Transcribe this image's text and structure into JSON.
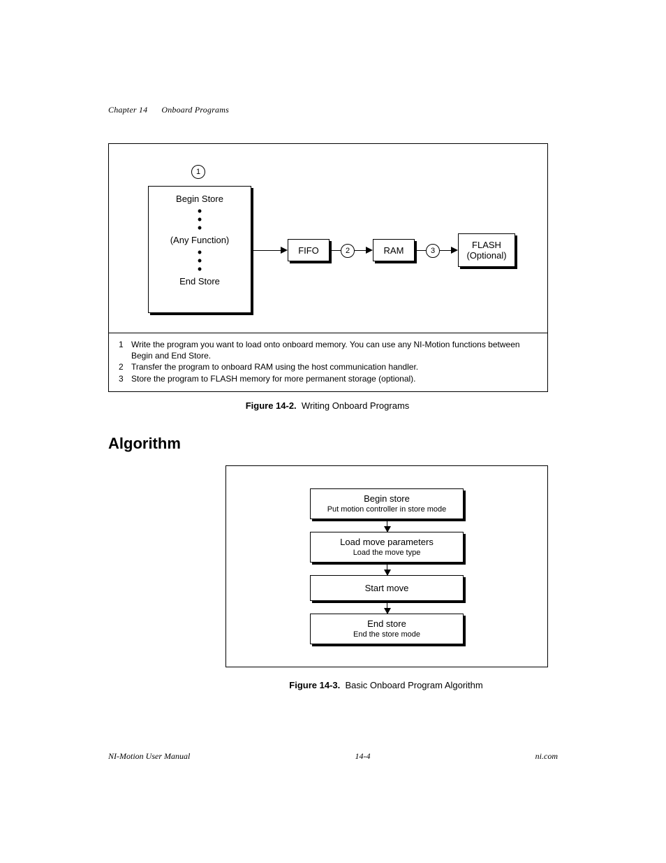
{
  "header": {
    "chapter": "Chapter 14",
    "title": "Onboard Programs"
  },
  "fig1": {
    "callout_top": "1",
    "callout_mid1": "2",
    "callout_mid2": "3",
    "box_store_begin": "Begin Store",
    "box_store_any": "(Any Function)",
    "box_store_end": "End Store",
    "box_fifo": "FIFO",
    "box_ram": "RAM",
    "box_flash_l1": "FLASH",
    "box_flash_l2": "(Optional)",
    "legend": {
      "n1": "1",
      "t1": "Write the program you want to load onto onboard memory. You can use any NI-Motion functions between Begin and End Store.",
      "n2": "2",
      "t2": "Transfer the program to onboard RAM using the host communication handler.",
      "n3": "3",
      "t3": "Store the program to FLASH memory for more permanent storage (optional)."
    },
    "caption_b": "Figure 14-2.",
    "caption_t": "Writing Onboard Programs"
  },
  "section": "Algorithm",
  "fig2": {
    "b1_l1": "Begin store",
    "b1_l2": "Put motion controller in store mode",
    "b2_l1": "Load move parameters",
    "b2_l2": "Load the move type",
    "b3_l1": "Start move",
    "b4_l1": "End store",
    "b4_l2": "End the store mode",
    "caption_b": "Figure 14-3.",
    "caption_t": "Basic Onboard Program Algorithm"
  },
  "footer": {
    "left": "NI-Motion User Manual",
    "center": "14-4",
    "right": "ni.com"
  }
}
